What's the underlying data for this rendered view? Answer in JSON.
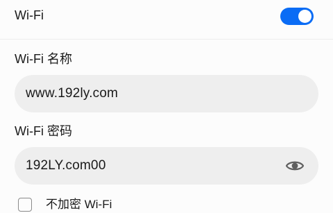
{
  "wifi": {
    "label": "Wi-Fi",
    "enabled": true,
    "accent_color": "#0a6cf5"
  },
  "name_field": {
    "label": "Wi-Fi 名称",
    "value": "www.192ly.com"
  },
  "password_field": {
    "label": "Wi-Fi 密码",
    "value": "192LY.com00",
    "visibility_icon": "eye-icon"
  },
  "no_encrypt": {
    "label": "不加密 Wi-Fi",
    "checked": false
  }
}
